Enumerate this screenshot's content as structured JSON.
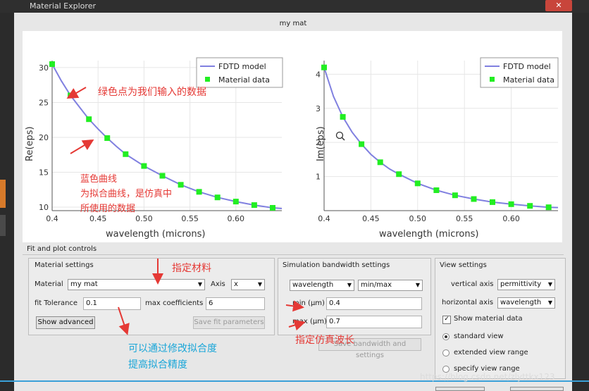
{
  "window": {
    "title": "Material Explorer",
    "close_glyph": "✕"
  },
  "heading": "my mat",
  "plot_left": {
    "ylabel": "Re(eps)",
    "xlabel": "wavelength (microns)",
    "yticks": [
      "10",
      "15",
      "20",
      "25",
      "30"
    ],
    "xticks": [
      "0.4",
      "0.45",
      "0.50",
      "0.55",
      "0.60"
    ],
    "legend": [
      "FDTD model",
      "Material data"
    ]
  },
  "plot_right": {
    "ylabel": "Im(eps)",
    "xlabel": "wavelength (microns)",
    "yticks": [
      "1",
      "2",
      "3",
      "4"
    ],
    "xticks": [
      "0.4",
      "0.45",
      "0.50",
      "0.55",
      "0.60"
    ],
    "legend": [
      "FDTD model",
      "Material data"
    ]
  },
  "chart_data": [
    {
      "type": "line",
      "ylabel": "Re(eps)",
      "xlabel": "wavelength (microns)",
      "xlim": [
        0.4,
        0.65
      ],
      "ylim": [
        9.5,
        31
      ],
      "grid": true,
      "legend_position": "top-right",
      "series": [
        {
          "name": "FDTD model",
          "x": [
            0.4,
            0.41,
            0.42,
            0.43,
            0.44,
            0.45,
            0.46,
            0.47,
            0.48,
            0.5,
            0.52,
            0.54,
            0.56,
            0.58,
            0.6,
            0.62,
            0.64,
            0.65
          ],
          "y": [
            30.5,
            28.1,
            26.0,
            24.3,
            22.6,
            21.2,
            19.9,
            18.7,
            17.6,
            15.9,
            14.5,
            13.2,
            12.2,
            11.4,
            10.8,
            10.3,
            9.9,
            9.8
          ]
        },
        {
          "name": "Material data",
          "x": [
            0.4,
            0.42,
            0.44,
            0.46,
            0.48,
            0.5,
            0.52,
            0.54,
            0.56,
            0.58,
            0.6,
            0.62,
            0.64
          ],
          "y": [
            30.5,
            26.0,
            22.6,
            19.9,
            17.6,
            15.9,
            14.5,
            13.2,
            12.2,
            11.4,
            10.8,
            10.3,
            9.9
          ]
        }
      ]
    },
    {
      "type": "line",
      "ylabel": "Im(eps)",
      "xlabel": "wavelength (microns)",
      "xlim": [
        0.4,
        0.65
      ],
      "ylim": [
        0,
        4.4
      ],
      "grid": true,
      "legend_position": "top-right",
      "series": [
        {
          "name": "FDTD model",
          "x": [
            0.4,
            0.41,
            0.42,
            0.43,
            0.44,
            0.45,
            0.46,
            0.47,
            0.48,
            0.5,
            0.52,
            0.54,
            0.56,
            0.58,
            0.6,
            0.62,
            0.64,
            0.65
          ],
          "y": [
            4.2,
            3.35,
            2.75,
            2.3,
            1.95,
            1.65,
            1.42,
            1.22,
            1.07,
            0.8,
            0.6,
            0.45,
            0.34,
            0.25,
            0.19,
            0.14,
            0.1,
            0.09
          ]
        },
        {
          "name": "Material data",
          "x": [
            0.4,
            0.42,
            0.44,
            0.46,
            0.48,
            0.5,
            0.52,
            0.54,
            0.56,
            0.58,
            0.6,
            0.62,
            0.64
          ],
          "y": [
            4.2,
            2.75,
            1.95,
            1.42,
            1.07,
            0.8,
            0.6,
            0.45,
            0.34,
            0.25,
            0.19,
            0.14,
            0.1
          ]
        }
      ]
    }
  ],
  "controls": {
    "title": "Fit and plot controls",
    "material_settings": {
      "title": "Material settings",
      "material_label": "Material",
      "material_value": "my mat",
      "axis_label": "Axis",
      "axis_value": "x",
      "fit_tolerance_label": "fit Tolerance",
      "fit_tolerance_value": "0.1",
      "max_coeff_label": "max coefficients",
      "max_coeff_value": "6",
      "show_advanced": "Show advanced",
      "save_fit": "Save fit parameters"
    },
    "simulation_bandwidth": {
      "title": "Simulation bandwidth settings",
      "mode_value": "wavelength",
      "range_value": "min/max",
      "min_label": "min (μm)",
      "min_value": "0.4",
      "max_label": "max (μm)",
      "max_value": "0.7",
      "save_btn": "Save bandwidth and settings"
    },
    "view_settings": {
      "title": "View settings",
      "vertical_label": "vertical axis",
      "vertical_value": "permittivity",
      "horizontal_label": "horizontal axis",
      "horizontal_value": "wavelength",
      "show_data": "Show material data",
      "radio_standard": "standard view",
      "radio_extended": "extended view range",
      "radio_specify": "specify view range"
    }
  },
  "annotations": {
    "green_points": "绿色点为我们输入的数据",
    "blue_curve_1": "蓝色曲线",
    "blue_curve_2": "为拟合曲线，是仿真中",
    "blue_curve_3": "所使用的数据",
    "specify_material": "指定材料",
    "fit_precision_1": "可以通过修改拟合度",
    "fit_precision_2": "提高拟合精度",
    "sim_wavelength": "指定仿真波长"
  },
  "watermark": "https://blog.csdn.net/zlyttkx123",
  "colors": {
    "model_line": "#8080e0",
    "data_point": "#22ee22",
    "annotation_red": "#e53935",
    "annotation_blue": "#1aa6d8"
  }
}
